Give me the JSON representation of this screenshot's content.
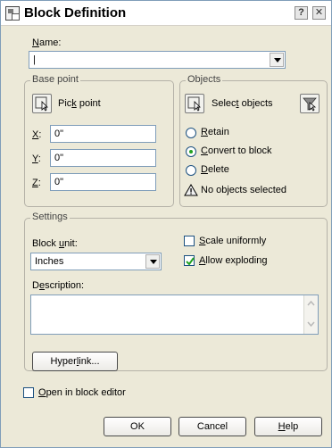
{
  "window": {
    "title": "Block Definition",
    "help_button": "?",
    "close_button": "✕"
  },
  "name": {
    "label": "Name:",
    "value": "|"
  },
  "base_point": {
    "group_title": "Base point",
    "pick_point_label": "Pick point",
    "x_label": "X:",
    "x_value": "0\"",
    "y_label": "Y:",
    "y_value": "0\"",
    "z_label": "Z:",
    "z_value": "0\""
  },
  "objects": {
    "group_title": "Objects",
    "select_objects_label": "Select objects",
    "retain_label": "Retain",
    "convert_label": "Convert to block",
    "delete_label": "Delete",
    "selected_option": "Convert to block",
    "status_text": "No objects selected"
  },
  "settings": {
    "group_title": "Settings",
    "block_unit_label": "Block unit:",
    "block_unit_value": "Inches",
    "scale_uniformly_label": "Scale uniformly",
    "scale_uniformly_checked": false,
    "allow_exploding_label": "Allow exploding",
    "allow_exploding_checked": true,
    "description_label": "Description:",
    "description_value": "",
    "hyperlink_label": "Hyperlink..."
  },
  "open_in_block_editor": {
    "label": "Open in block editor",
    "checked": false
  },
  "footer": {
    "ok_label": "OK",
    "cancel_label": "Cancel",
    "help_label": "Help"
  },
  "colors": {
    "dialog_bg": "#ece9d8",
    "field_border": "#7f9db9",
    "radio_dot": "#21a121"
  }
}
